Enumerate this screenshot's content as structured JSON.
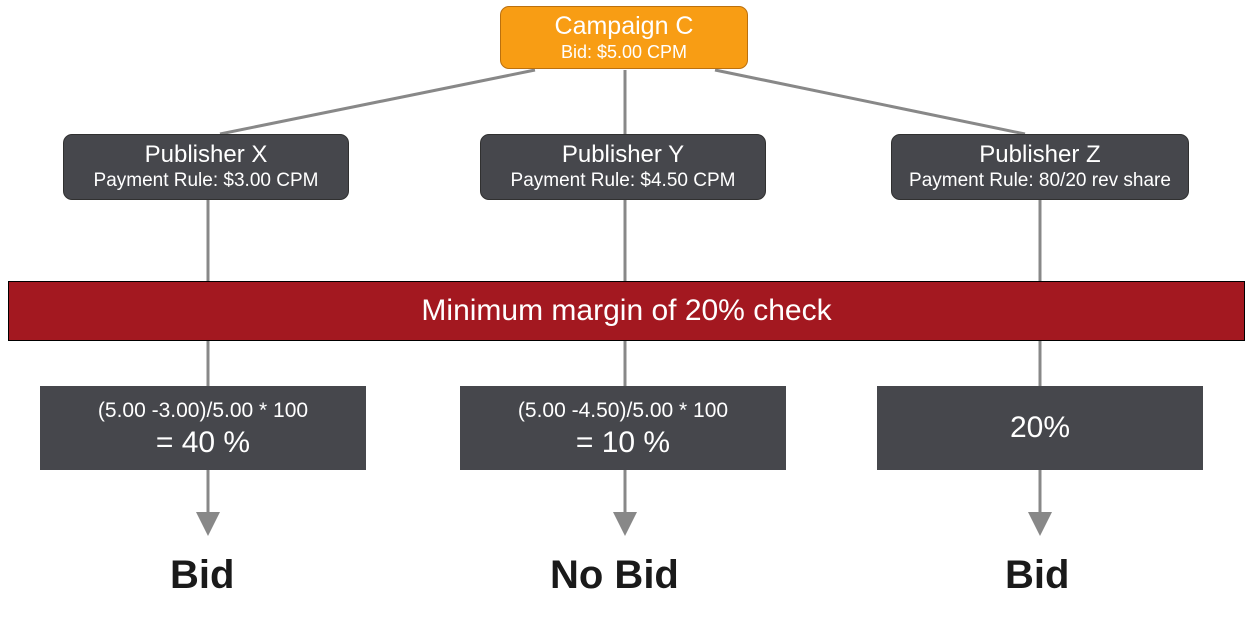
{
  "campaign": {
    "title": "Campaign C",
    "bid": "Bid: $5.00 CPM"
  },
  "publishers": {
    "x": {
      "title": "Publisher X",
      "rule": "Payment Rule: $3.00 CPM"
    },
    "y": {
      "title": "Publisher Y",
      "rule": "Payment Rule: $4.50 CPM"
    },
    "z": {
      "title": "Publisher Z",
      "rule": "Payment Rule: 80/20 rev share"
    }
  },
  "check": {
    "label": "Minimum margin of 20% check"
  },
  "calcs": {
    "x": {
      "formula": "(5.00 -3.00)/5.00 * 100",
      "result": "= 40 %"
    },
    "y": {
      "formula": "(5.00 -4.50)/5.00 * 100",
      "result": "= 10 %"
    },
    "z": {
      "result": "20%"
    }
  },
  "outcomes": {
    "x": "Bid",
    "y": "No Bid",
    "z": "Bid"
  }
}
